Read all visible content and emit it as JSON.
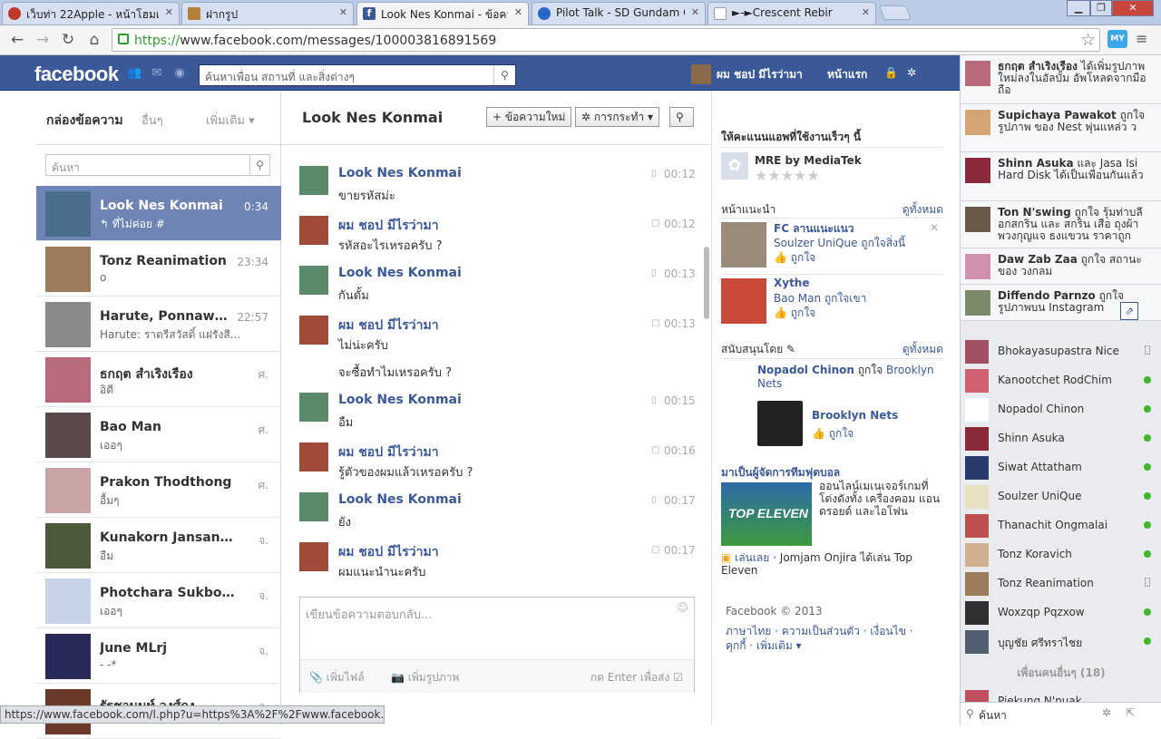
{
  "browser": {
    "tabs": [
      {
        "title": "เว็บท่า 22Apple - หน้าโฮมเพ",
        "color": "#c0392b"
      },
      {
        "title": "ฝากรูป",
        "color": "#b5803a"
      },
      {
        "title": "Look Nes Konmai - ข้อความ",
        "color": "#3b5998"
      },
      {
        "title": "Pilot Talk - SD Gundam C",
        "color": "#2a65c9"
      },
      {
        "title": "►-►Crescent Rebir",
        "color": "#888888"
      }
    ],
    "url_https": "https://",
    "url_rest": "www.facebook.com/messages/100003816891569",
    "ext_label": "MY",
    "status_url": "https://www.facebook.com/l.php?u=https%3A%2F%2Fwww.facebook.com%..."
  },
  "header": {
    "logo": "facebook",
    "search_placeholder": "ค้นหาเพื่อน สถานที่ และสิ่งต่างๆ",
    "user_name": "ผม ชอป มีไรว่ามา",
    "home": "หน้าแรก"
  },
  "inbox": {
    "title": "กล่องข้อความ",
    "other": "อื่นๆ",
    "more": "เพิ่มเติม",
    "search_placeholder": "ค้นหา",
    "threads": [
      {
        "name": "Look Nes Konmai",
        "snippet": "↰ ที่ไม่ค่อย #",
        "time": "0:34",
        "color": "#4a6d8c"
      },
      {
        "name": "Tonz Reanimation",
        "snippet": "o",
        "time": "23:34",
        "color": "#9c7b5a"
      },
      {
        "name": "Harute, Ponnawat,...",
        "snippet": "Harute: ราตรีสวัสดิ์ แฝรังสี...",
        "time": "22:57",
        "color": "#8a8a8a"
      },
      {
        "name": "ธกฤต สำเริงเรือง",
        "snippet": "อิดี",
        "time": "ศ.",
        "color": "#b86a7a"
      },
      {
        "name": "Bao Man",
        "snippet": "เออๆ",
        "time": "ศ.",
        "color": "#5a4a4a"
      },
      {
        "name": "Prakon Thodthong",
        "snippet": "อื้มๆ",
        "time": "ศ.",
        "color": "#c9a5a5"
      },
      {
        "name": "Kunakorn Jansanga",
        "snippet": "อืม",
        "time": "จ.",
        "color": "#4a5a3a"
      },
      {
        "name": "Photchara Sukboony...",
        "snippet": "เออๆ",
        "time": "จ.",
        "color": "#c7d3e6"
      },
      {
        "name": "June MLrj",
        "snippet": "- -*",
        "time": "จ.",
        "color": "#2a2a5a"
      },
      {
        "name": "รัฐชานนท์ วงศ์ถง",
        "snippet": "",
        "time": "จ.",
        "color": "#6a3a2a"
      }
    ]
  },
  "conversation": {
    "title": "Look Nes Konmai",
    "new_message": "+ ข้อความใหม่",
    "actions": "✲ การกระทำ ▾",
    "messages": [
      {
        "name": "Look Nes Konmai",
        "text": "ขายรหัสม่ะ",
        "time": "00:12",
        "device": "▯",
        "self": false
      },
      {
        "name": "ผม ชอป มีไรว่ามา",
        "text": "รหัสอะไรเหรอครับ ?",
        "time": "00:12",
        "device": "▢",
        "self": true
      },
      {
        "name": "Look Nes Konmai",
        "text": "กันดั้ม",
        "time": "00:13",
        "device": "▯",
        "self": false
      },
      {
        "name": "ผม ชอป มีไรว่ามา",
        "text": "ไม่น่ะครับ",
        "text2": "จะซื้อทำไมเหรอครับ ?",
        "time": "00:13",
        "device": "▢",
        "self": true
      },
      {
        "name": "Look Nes Konmai",
        "text": "อืม",
        "time": "00:15",
        "device": "▯",
        "self": false
      },
      {
        "name": "ผม ชอป มีไรว่ามา",
        "text": "รู้ตัวของผมแล้วเหรอครับ ?",
        "time": "00:16",
        "device": "▢",
        "self": true
      },
      {
        "name": "Look Nes Konmai",
        "text": "ยัง",
        "time": "00:17",
        "device": "▯",
        "self": false
      },
      {
        "name": "ผม ชอป มีไรว่ามา",
        "text": "ผมแนะนำนะครับ",
        "time": "00:17",
        "device": "▢",
        "self": true
      }
    ],
    "reply_placeholder": "เขียนข้อความตอบกลับ...",
    "add_file": "เพิ่มไฟล์",
    "add_photo": "เพิ่มรูปภาพ",
    "enter_to_send": "กด Enter เพื่อส่ง"
  },
  "rightcol": {
    "rate_title": "ให้คะแนนแอพที่ใช้งานเร็วๆ นี้",
    "app_name": "MRE by MediaTek",
    "pages_title": "หน้าแนะนำ",
    "see_all": "ดูทั้งหมด",
    "page1_name": "FC ลานแนะแนว",
    "page1_desc": "Soulzer UniQue ถูกใจสิ่งนี้",
    "like": "ถูกใจ",
    "page2_name": "Xythe",
    "page2_desc": "Bao Man ถูกใจเขา",
    "sponsored_title": "สนับสนุนโดย",
    "sp_line1_name": "Nopadol Chinon",
    "sp_line1_mid": "ถูกใจ",
    "sp_line1_target": "Brooklyn Nets",
    "sp_name": "Brooklyn Nets",
    "game_title": "มาเป็นผู้จัดการทีมฟุตบอล",
    "game_desc": "ออนไลน์เมเนเจอร์เกมที่โด่งดังทั้ง เครื่องคอม แอนดรอยด์ และไอโฟน",
    "game_logo": "TOP ELEVEN",
    "play": "เล่นเลย",
    "play_desc": "· Jomjam Onjira ได้เล่น Top Eleven",
    "footer_copy": "Facebook © 2013",
    "footer_links": "ภาษาไทย · ความเป็นส่วนตัว · เงื่อนไข ·",
    "footer_links2": "คุกกี้ · เพิ่มเติม ▾"
  },
  "ticker": [
    {
      "text_b": "ธกฤต สำเริงเรือง",
      "text": " ได้เพิ่มรูปภาพใหม่ลงในอัลบั้ม อัพโหลดจากมือถือ",
      "color": "#b86a7a"
    },
    {
      "text_b": "Supichaya Pawakot",
      "text": " ถูกใจ รูปภาพ ของ Nest พุ่นแหล่ว ว",
      "color": "#d4a574"
    },
    {
      "text_b": "Shinn Asuka",
      "text": " และ Jasa Isi Hard Disk ได้เป็นเพื่อนกันแล้ว",
      "color": "#8b2a3a"
    },
    {
      "text_b": "Ton N'swing",
      "text": " ถูกใจ รุ้มท่าบลีอกสกริน และ สกริน เสือ ถุงผ้าพวงกุญแจ ธงแขวน ราคาถูก",
      "color": "#6a5a4a"
    },
    {
      "text_b": "Daw Zab Zaa",
      "text": " ถูกใจ สถานะ ของ วงกลม",
      "color": "#d090b0"
    },
    {
      "text_b": "Diffendo Parnzo",
      "text": " ถูกใจรูปภาพบน Instagram",
      "color": "#7a8a6a"
    }
  ],
  "chat_friends": [
    {
      "name": "Bhokayasupastra Nice",
      "status": "mobile",
      "color": "#a05060"
    },
    {
      "name": "Kanootchet RodChim",
      "status": "online",
      "color": "#d06070"
    },
    {
      "name": "Nopadol Chinon",
      "status": "online",
      "color": "#ffffff"
    },
    {
      "name": "Shinn Asuka",
      "status": "online",
      "color": "#8b2a3a"
    },
    {
      "name": "Siwat Attatham",
      "status": "online",
      "color": "#2a3a6a"
    },
    {
      "name": "Soulzer UniQue",
      "status": "online",
      "color": "#e8e0c0"
    },
    {
      "name": "Thanachit Ongmalai",
      "status": "online",
      "color": "#c05050"
    },
    {
      "name": "Tonz Koravich",
      "status": "online",
      "color": "#d0b090"
    },
    {
      "name": "Tonz Reanimation",
      "status": "mobile",
      "color": "#9c7b5a"
    },
    {
      "name": "Woxzqp Pqzxow",
      "status": "online",
      "color": "#303030"
    },
    {
      "name": "บุญชัย ศรีทราไชย",
      "status": "online",
      "color": "#506070"
    }
  ],
  "chat_more": "เพื่อนคนอื่นๆ (18)",
  "chat_last": "Piekung N'nuak",
  "chat_search": "ค้นหา"
}
